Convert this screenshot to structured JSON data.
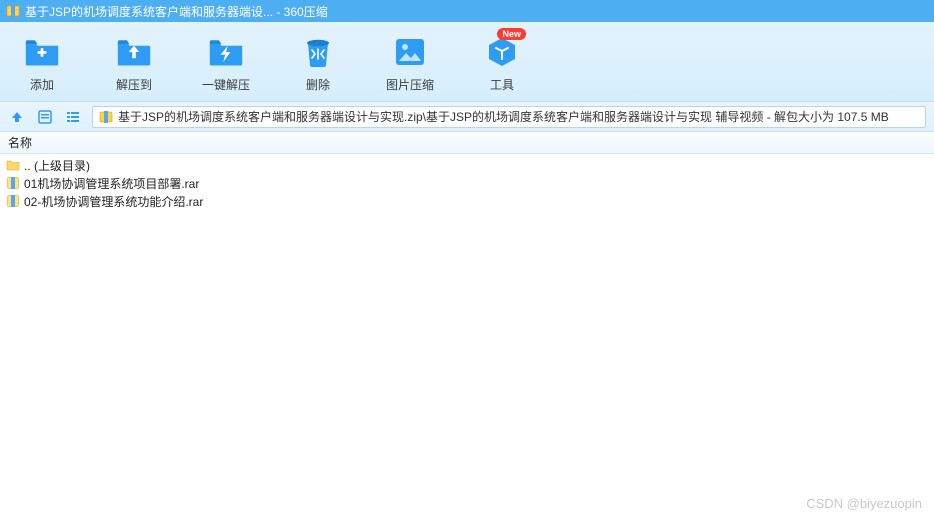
{
  "window": {
    "title": "基于JSP的机场调度系统客户端和服务器端设... - 360压缩"
  },
  "toolbar": {
    "add": "添加",
    "extract_to": "解压到",
    "one_click": "一键解压",
    "delete": "删除",
    "image_compress": "图片压缩",
    "tools": "工具",
    "new_badge": "New"
  },
  "path": {
    "text": "基于JSP的机场调度系统客户端和服务器端设计与实现.zip\\基于JSP的机场调度系统客户端和服务器端设计与实现 辅导视频 - 解包大小为 107.5 MB"
  },
  "columns": {
    "name": "名称"
  },
  "files": {
    "parent": ".. (上级目录)",
    "f1": "01机场协调管理系统项目部署.rar",
    "f2": "02-机场协调管理系统功能介绍.rar"
  },
  "watermark": "CSDN @biyezuopin"
}
